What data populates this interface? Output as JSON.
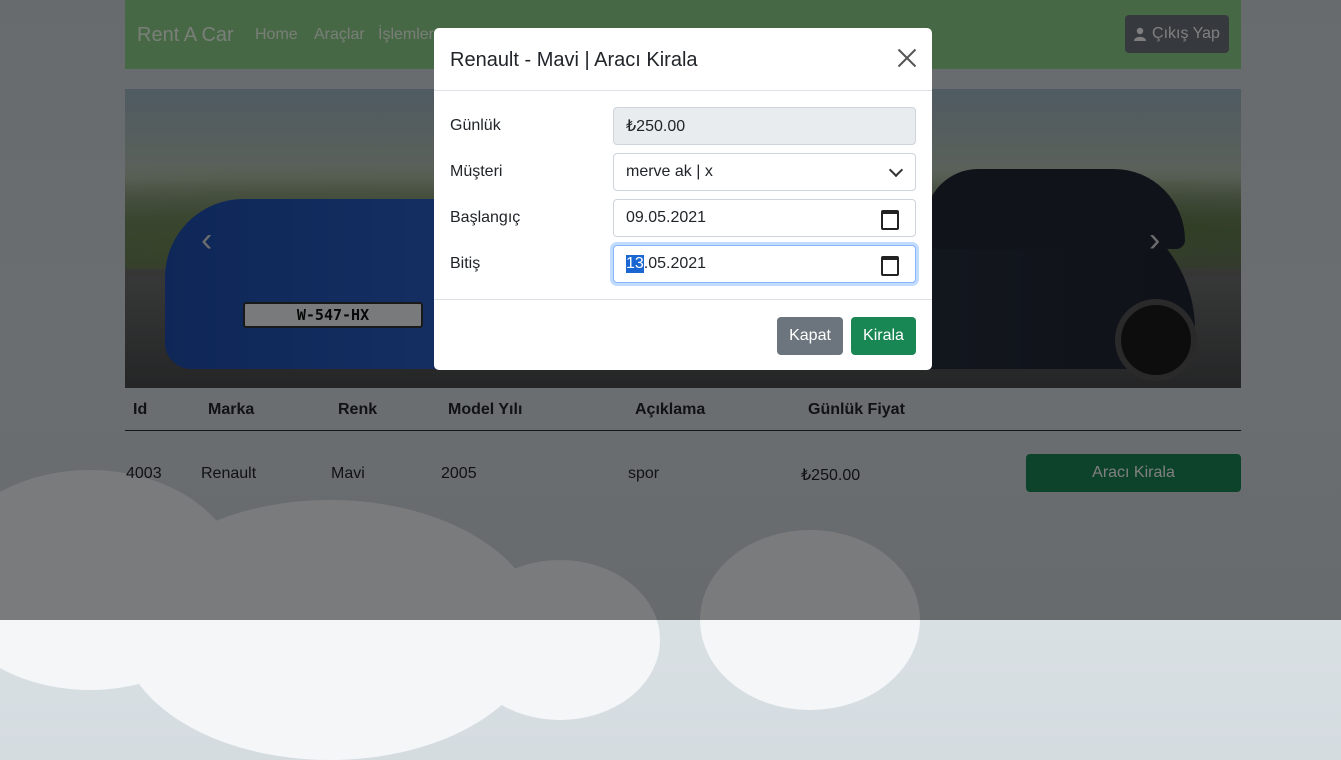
{
  "navbar": {
    "brand": "Rent A Car",
    "links": [
      "Home",
      "Araçlar",
      "İşlemler"
    ],
    "logout_label": "Çıkış Yap",
    "logout_icon": "user-icon"
  },
  "carousel": {
    "plate": "W-547-HX",
    "prev_icon": "chevron-left-icon",
    "next_icon": "chevron-right-icon"
  },
  "table": {
    "headers": [
      "Id",
      "Marka",
      "Renk",
      "Model Yılı",
      "Açıklama",
      "Günlük Fiyat"
    ],
    "rows": [
      {
        "id": "4003",
        "brand": "Renault",
        "color": "Mavi",
        "model_year": "2005",
        "description": "spor",
        "daily_price": "₺250.00",
        "action": "Aracı Kirala"
      }
    ]
  },
  "modal": {
    "title": "Renault - Mavi | Aracı Kirala",
    "fields": {
      "daily_label": "Günlük",
      "daily_value": "₺250.00",
      "customer_label": "Müşteri",
      "customer_value": "merve ak | x",
      "start_label": "Başlangıç",
      "start_value": "09.05.2021",
      "end_label": "Bitiş",
      "end_value_selected": "13",
      "end_value_rest": ".05.2021"
    },
    "buttons": {
      "close": "Kapat",
      "rent": "Kirala"
    }
  },
  "colors": {
    "navbar": "#8fd18a",
    "success": "#198754",
    "secondary": "#6c757d"
  }
}
